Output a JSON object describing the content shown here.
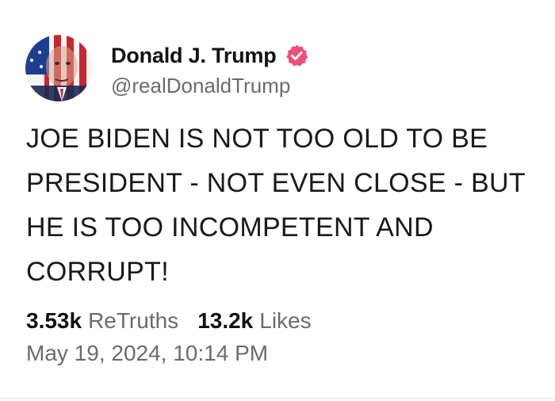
{
  "post": {
    "author": {
      "display_name": "Donald J. Trump",
      "handle": "@realDonaldTrump",
      "verified_icon": "verified-badge-icon",
      "avatar_icon": "avatar-image"
    },
    "text": "JOE BIDEN IS NOT TOO OLD TO BE PRESIDENT - NOT EVEN CLOSE - BUT HE IS TOO INCOMPETENT AND CORRUPT!",
    "stats": {
      "retruths_count": "3.53k",
      "retruths_label": "ReTruths",
      "likes_count": "13.2k",
      "likes_label": "Likes"
    },
    "timestamp": "May 19, 2024, 10:14 PM"
  },
  "colors": {
    "verified_badge": "#ee4f7a",
    "secondary_text": "#6b6b6b",
    "primary_text": "#111111",
    "divider": "#e6e6e6"
  }
}
